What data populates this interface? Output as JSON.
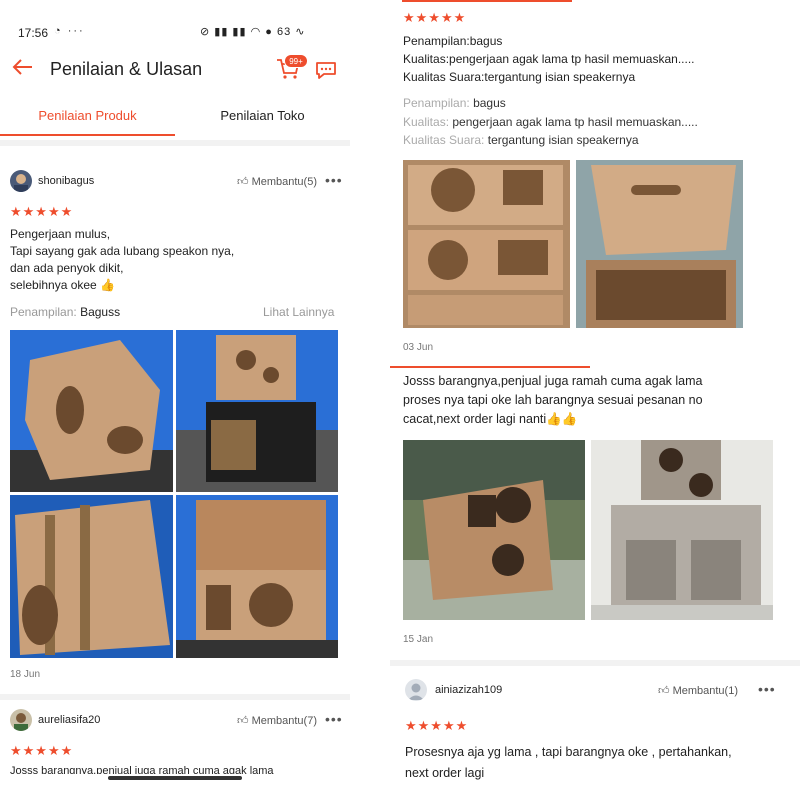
{
  "status_bar": {
    "time": "17:56",
    "battery": "63"
  },
  "header": {
    "title": "Penilaian & Ulasan",
    "cart_badge": "99+"
  },
  "tabs": [
    {
      "label": "Penilaian Produk"
    },
    {
      "label": "Penilaian Toko"
    }
  ],
  "review1": {
    "username": "shonibagus",
    "helpful": "Membantu(5)",
    "stars": "★★★★★",
    "text": "Pengerjaan mulus,\nTapi sayang gak ada lubang speakon nya,\ndan ada penyok dikit,\nselebihnya okee 👍",
    "meta_label": "Penampilan:",
    "meta_value": "Baguss",
    "see_more": "Lihat Lainnya",
    "date": "18 Jun"
  },
  "review2": {
    "username": "aureliasifa20",
    "helpful": "Membantu(7)",
    "stars": "★★★★★",
    "text_cut": "Josss barangnya,penjual juga ramah cuma agak lama"
  },
  "right_top": {
    "stars": "★★★★★",
    "text": "Penampilan:bagus\nKualitas:pengerjaan agak lama tp hasil memuaskan.....\nKualitas Suara:tergantung isian speakernya",
    "meta": [
      {
        "label": "Penampilan:",
        "value": "bagus"
      },
      {
        "label": "Kualitas:",
        "value": "pengerjaan agak lama tp hasil memuaskan....."
      },
      {
        "label": "Kualitas Suara:",
        "value": "tergantung isian speakernya"
      }
    ],
    "date": "03 Jun"
  },
  "right_mid": {
    "text": "Josss barangnya,penjual juga ramah cuma agak lama\nproses nya tapi oke lah barangnya sesuai pesanan no\ncacat,next order lagi nanti👍👍",
    "date": "15 Jan"
  },
  "right_bottom": {
    "username": "ainiazizah109",
    "helpful": "Membantu(1)",
    "stars": "★★★★★",
    "text": "Prosesnya aja yg lama , tapi barangnya oke , pertahankan,\nnext order lagi"
  },
  "colors": {
    "accent": "#ee4d2d",
    "wood": "#c9a07a",
    "blue_wall": "#2a6fd6"
  },
  "icons": [
    "back-arrow-icon",
    "cart-icon",
    "chat-icon",
    "thumbs-up-icon",
    "more-icon",
    "avatar-icon"
  ]
}
